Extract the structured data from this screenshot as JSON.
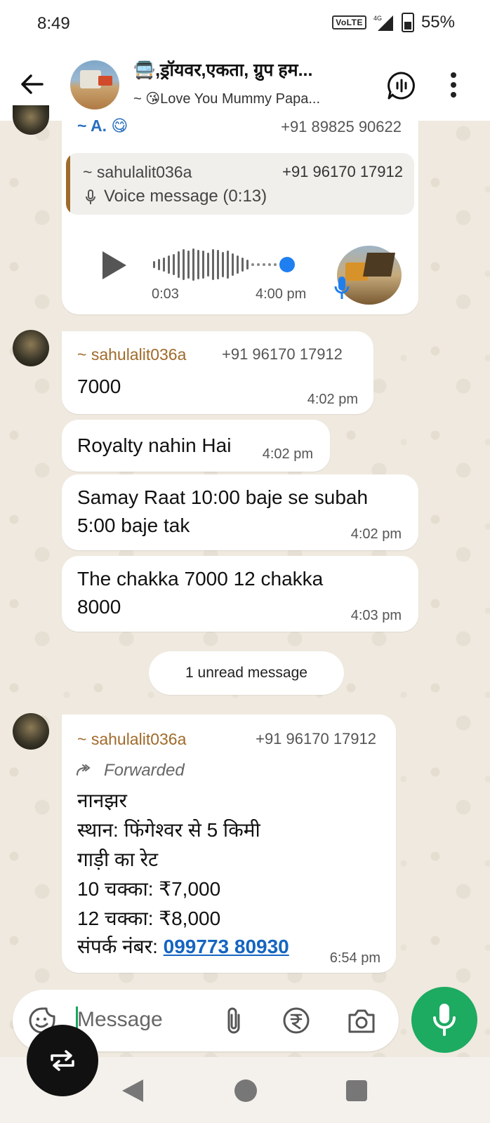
{
  "status": {
    "time": "8:49",
    "network": "VoLTE",
    "signal": "4G",
    "battery": "55%"
  },
  "header": {
    "title": "🚍,ड्रॉयवर,एकता, ग्रुप हम...",
    "subtitle": "~ 😘Love You Mummy Papa..."
  },
  "messages": {
    "top_partial": {
      "sender": "~ A. 😋",
      "phone": "+91 89825 90622",
      "quote_sender": "~ sahulalit036a",
      "quote_phone": "+91 96170 17912",
      "quote_text": "Voice message (0:13)",
      "elapsed": "0:03",
      "time": "4:00 pm"
    },
    "m1": {
      "sender": "~ sahulalit036a",
      "phone": "+91 96170 17912",
      "text": "7000",
      "time": "4:02 pm"
    },
    "m2": {
      "text": "Royalty nahin Hai",
      "time": "4:02 pm"
    },
    "m3": {
      "line1": "Samay Raat 10:00 baje se subah",
      "line2": "5:00 baje tak",
      "time": "4:02 pm"
    },
    "m4": {
      "line1": "The chakka 7000 12 chakka",
      "line2": "8000",
      "time": "4:03 pm"
    },
    "unread_label": "1 unread message",
    "m5": {
      "sender": "~ sahulalit036a",
      "phone": "+91 96170 17912",
      "forwarded": "Forwarded",
      "line1": "नानझर",
      "line2": "स्थान: फिंगेश्वर से 5 किमी",
      "line3": "गाड़ी का रेट",
      "line4": "10 चक्का: ₹7,000",
      "line5": "12 चक्का: ₹8,000",
      "line6_prefix": "संपर्क नंबर: ",
      "line6_link": "099773 80930",
      "time": "6:54 pm"
    }
  },
  "composer": {
    "placeholder": "Message"
  }
}
